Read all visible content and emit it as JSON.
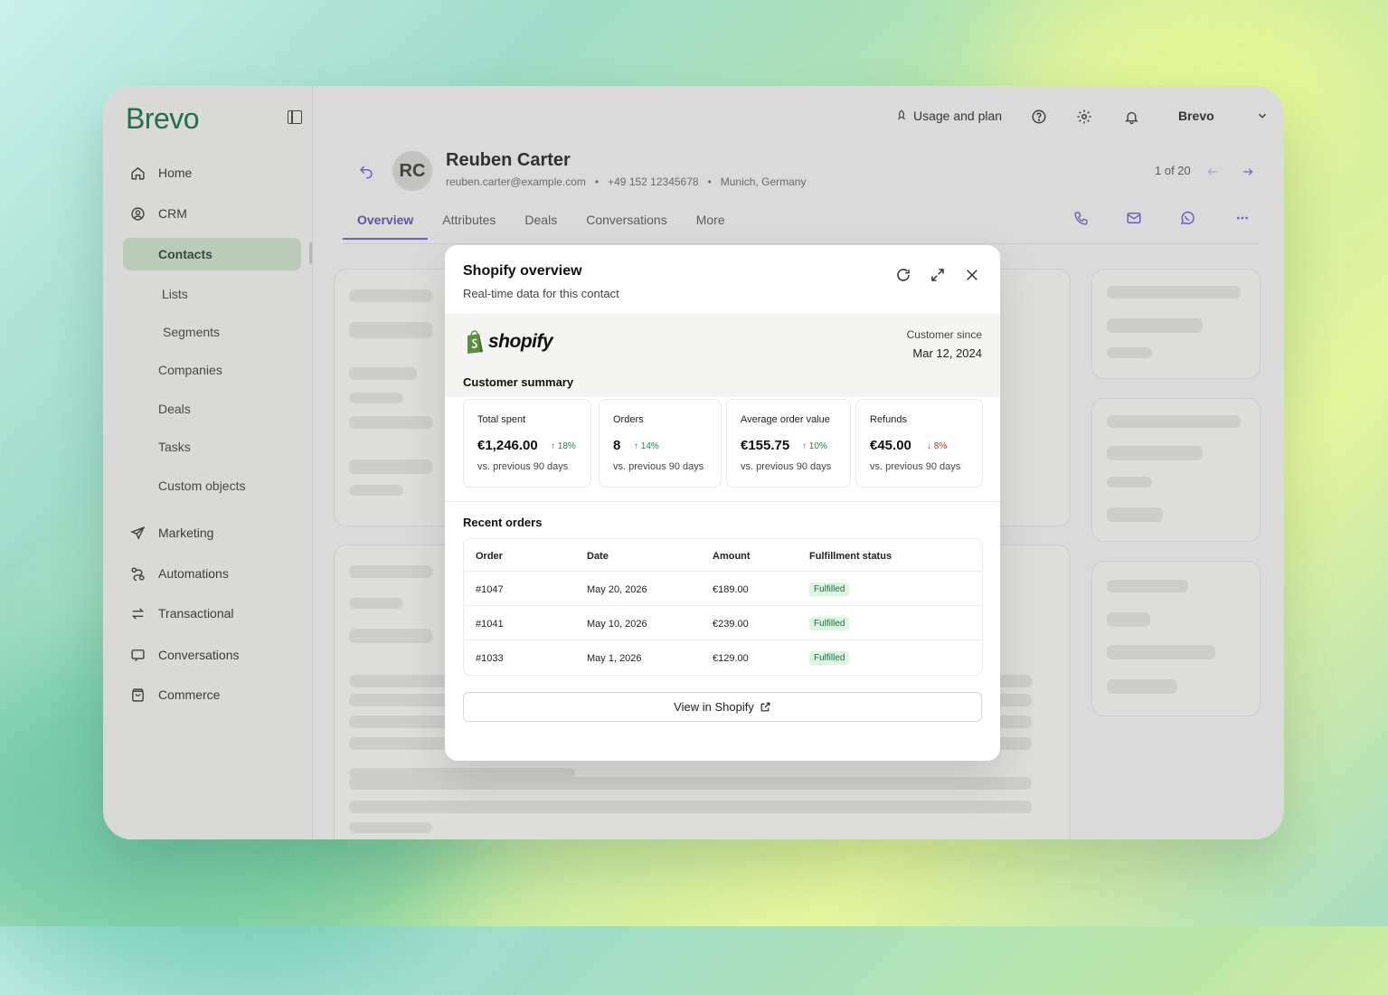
{
  "app": {
    "logo": "Brevo"
  },
  "sidebar": {
    "items": [
      {
        "label": "Home",
        "icon": "home-icon"
      },
      {
        "label": "CRM",
        "icon": "crm-icon"
      },
      {
        "label": "Contacts"
      },
      {
        "label": "Lists"
      },
      {
        "label": "Segments"
      },
      {
        "label": "Companies"
      },
      {
        "label": "Deals"
      },
      {
        "label": "Tasks"
      },
      {
        "label": "Custom objects"
      },
      {
        "label": "Marketing",
        "icon": "send-icon"
      },
      {
        "label": "Automations",
        "icon": "automation-icon"
      },
      {
        "label": "Transactional",
        "icon": "transfer-icon"
      },
      {
        "label": "Conversations",
        "icon": "chat-icon"
      },
      {
        "label": "Commerce",
        "icon": "bag-icon"
      }
    ]
  },
  "topbar": {
    "usage": "Usage and plan",
    "account": "Brevo"
  },
  "contact": {
    "initials": "RC",
    "name": "Reuben Carter",
    "email": "reuben.carter@example.com",
    "phone": "+49 152 12345678",
    "location": "Munich, Germany",
    "pager": "1 of 20"
  },
  "tabs": [
    "Overview",
    "Attributes",
    "Deals",
    "Conversations",
    "More"
  ],
  "modal": {
    "title": "Shopify overview",
    "subtitle": "Real-time data for this contact",
    "brand": "shopify",
    "since_label": "Customer since",
    "since_value": "Mar 12, 2024",
    "summary_title": "Customer summary",
    "stats": [
      {
        "label": "Total spent",
        "value": "€1,246.00",
        "change": "18%",
        "direction": "up",
        "compare": "vs. previous 90 days"
      },
      {
        "label": "Orders",
        "value": "8",
        "change": "14%",
        "direction": "up",
        "compare": "vs. previous 90 days"
      },
      {
        "label": "Average order value",
        "value": "€155.75",
        "change": "10%",
        "direction": "up",
        "compare": "vs. previous 90 days"
      },
      {
        "label": "Refunds",
        "value": "€45.00",
        "change": "8%",
        "direction": "down",
        "compare": "vs. previous 90 days"
      }
    ],
    "orders_title": "Recent orders",
    "columns": [
      "Order",
      "Date",
      "Amount",
      "Fulfillment status"
    ],
    "orders": [
      {
        "order": "#1047",
        "date": "May 20, 2026",
        "amount": "€189.00",
        "status": "Fulfilled"
      },
      {
        "order": "#1041",
        "date": "May 10, 2026",
        "amount": "€239.00",
        "status": "Fulfilled"
      },
      {
        "order": "#1033",
        "date": "May 1, 2026",
        "amount": "€129.00",
        "status": "Fulfilled"
      }
    ],
    "view_button": "View in Shopify"
  },
  "colors": {
    "accent": "#6b5bd0",
    "brand_green": "#0b6b4a",
    "active_nav": "#cde5c9",
    "success": "#1f8a4c",
    "danger": "#d0342c"
  }
}
